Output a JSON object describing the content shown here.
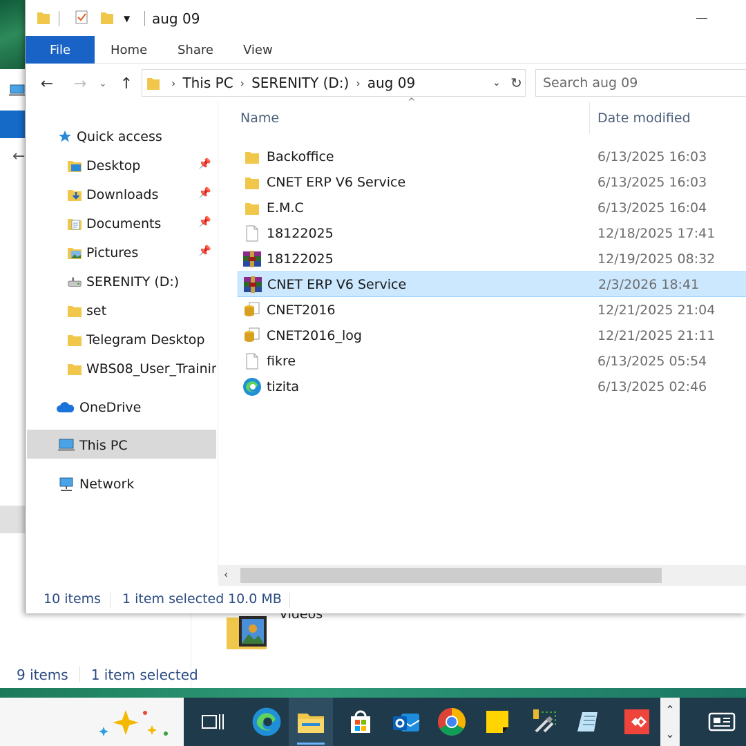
{
  "window": {
    "title": "aug 09",
    "ribbon_tabs": [
      "File",
      "Home",
      "Share",
      "View"
    ]
  },
  "address": {
    "crumbs": [
      "This PC",
      "SERENITY (D:)",
      "aug 09"
    ],
    "search_placeholder": "Search aug 09"
  },
  "nav": {
    "quick_access": "Quick access",
    "items": [
      {
        "label": "Desktop",
        "pinned": true
      },
      {
        "label": "Downloads",
        "pinned": true
      },
      {
        "label": "Documents",
        "pinned": true
      },
      {
        "label": "Pictures",
        "pinned": true
      },
      {
        "label": "SERENITY (D:)",
        "pinned": false
      },
      {
        "label": "set",
        "pinned": false
      },
      {
        "label": "Telegram Desktop",
        "pinned": false
      },
      {
        "label": "WBS08_User_Trainin",
        "pinned": false
      }
    ],
    "onedrive": "OneDrive",
    "this_pc": "This PC",
    "network": "Network"
  },
  "columns": {
    "name": "Name",
    "date": "Date modified"
  },
  "files": [
    {
      "name": "Backoffice",
      "date": "6/13/2025 16:03",
      "icon": "folder-icon"
    },
    {
      "name": "CNET ERP V6 Service",
      "date": "6/13/2025 16:03",
      "icon": "folder-icon"
    },
    {
      "name": "E.M.C",
      "date": "6/13/2025 16:04",
      "icon": "folder-icon"
    },
    {
      "name": "18122025",
      "date": "12/18/2025 17:41",
      "icon": "blank-file-icon"
    },
    {
      "name": "18122025",
      "date": "12/19/2025 08:32",
      "icon": "winrar-archive-icon"
    },
    {
      "name": "CNET ERP V6 Service",
      "date": "2/3/2026 18:41",
      "icon": "winrar-archive-icon",
      "selected": true
    },
    {
      "name": "CNET2016",
      "date": "12/21/2025 21:04",
      "icon": "database-file-icon"
    },
    {
      "name": "CNET2016_log",
      "date": "12/21/2025 21:11",
      "icon": "database-file-icon"
    },
    {
      "name": "fikre",
      "date": "6/13/2025 05:54",
      "icon": "blank-file-icon"
    },
    {
      "name": "tizita",
      "date": "6/13/2025 02:46",
      "icon": "edge-file-icon"
    }
  ],
  "status": {
    "count": "10 items",
    "selected": "1 item selected",
    "size": "10.0 MB"
  },
  "background": {
    "videos_label": "Videos",
    "status_count": "9 items",
    "status_selected": "1 item selected"
  },
  "taskbar": {
    "apps": [
      "copilot-icon",
      "task-view-icon",
      "edge-icon",
      "file-explorer-icon",
      "microsoft-store-icon",
      "outlook-icon",
      "chrome-icon",
      "sticky-notes-icon",
      "tools-icon",
      "notepad-icon",
      "anydesk-icon",
      "news-icon"
    ]
  },
  "colors": {
    "accent": "#1a63c6",
    "selection": "#cce8ff",
    "taskbar": "#1f3a4a"
  }
}
